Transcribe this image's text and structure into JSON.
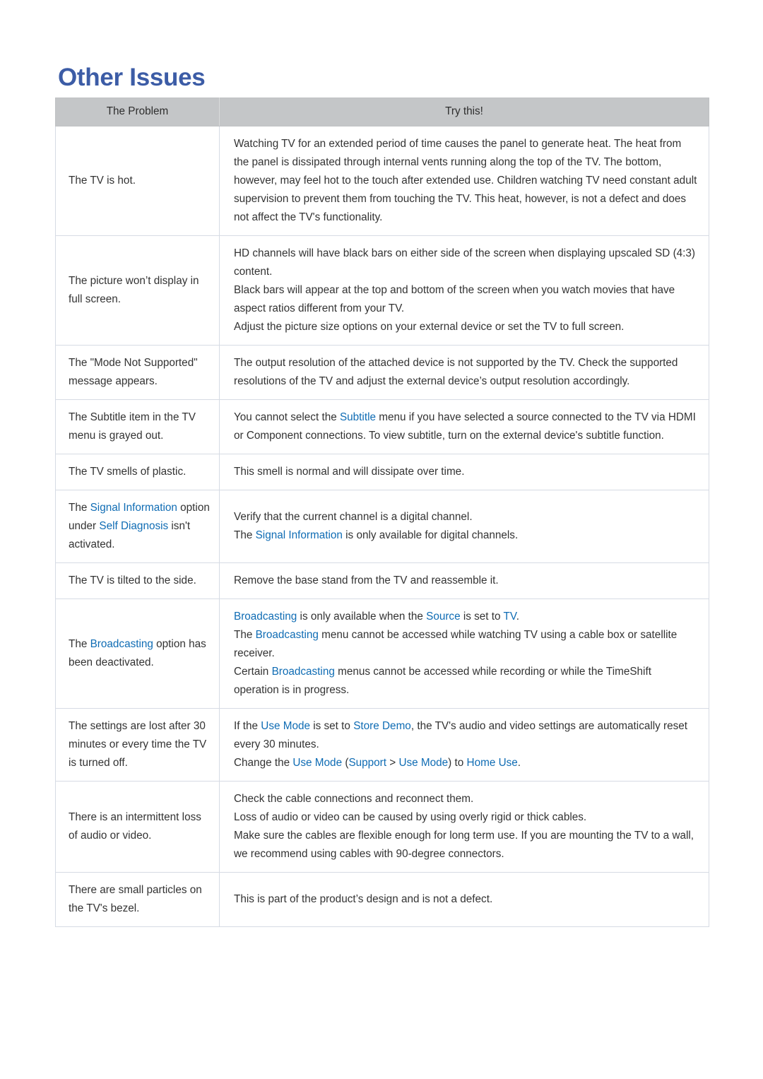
{
  "page": {
    "title": "Other Issues",
    "title_color": "#3c5ca6",
    "link_color": "#0f6cb4",
    "header_bg": "#c4c6c8"
  },
  "table": {
    "headers": {
      "problem": "The Problem",
      "try_this": "Try this!"
    },
    "rows": [
      {
        "problem_plain": "The TV is hot.",
        "problem_html": "The TV is hot.",
        "solution_lines_plain": [
          "Watching TV for an extended period of time causes the panel to generate heat. The heat from the panel is dissipated through internal vents running along the top of the TV. The bottom, however, may feel hot to the touch after extended use. Children watching TV need constant adult supervision to prevent them from touching the TV. This heat, however, is not a defect and does not affect the TV's functionality."
        ],
        "solution_html": "<span class=\"line\">Watching TV for an extended period of time causes the panel to generate heat. The heat from the panel is dissipated through internal vents running along the top of the TV. The bottom, however, may feel hot to the touch after extended use. Children watching TV need constant adult supervision to prevent them from touching the TV. This heat, however, is not a defect and does not affect the TV's functionality.</span>"
      },
      {
        "problem_plain": "The picture won’t display in full screen.",
        "problem_html": "The picture won’t display in full screen.",
        "solution_lines_plain": [
          "HD channels will have black bars on either side of the screen when displaying upscaled SD (4:3) content.",
          "Black bars will appear at the top and bottom of the screen when you watch movies that have aspect ratios different from your TV.",
          "Adjust the picture size options on your external device or set the TV to full screen."
        ],
        "solution_html": "<span class=\"line\">HD channels will have black bars on either side of the screen when displaying upscaled SD (4:3) content.</span><span class=\"line\">Black bars will appear at the top and bottom of the screen when you watch movies that have aspect ratios different from your TV.</span><span class=\"line\">Adjust the picture size options on your external device or set the TV to full screen.</span>"
      },
      {
        "problem_plain": "The \"Mode Not Supported\" message appears.",
        "problem_html": "The \"Mode Not Supported\" message appears.",
        "solution_lines_plain": [
          "The output resolution of the attached device is not supported by the TV. Check the supported resolutions of the TV and adjust the external device’s output resolution accordingly."
        ],
        "solution_html": "<span class=\"line\">The output resolution of the attached device is not supported by the TV. Check the supported resolutions of the TV and adjust the external device’s output resolution accordingly.</span>"
      },
      {
        "problem_plain": "The Subtitle item in the TV menu is grayed out.",
        "problem_html": "The Subtitle item in the TV menu is grayed out.",
        "solution_lines_plain": [
          "You cannot select the Subtitle menu if you have selected a source connected to the TV via HDMI or Component connections. To view subtitle, turn on the external device's subtitle function."
        ],
        "solution_html": "<span class=\"line\">You cannot select the <span class=\"hl\">Subtitle</span> menu if you have selected a source connected to the TV via HDMI or Component connections. To view subtitle, turn on the external device's subtitle function.</span>"
      },
      {
        "problem_plain": "The TV smells of plastic.",
        "problem_html": "The TV smells of plastic.",
        "solution_lines_plain": [
          "This smell is normal and will dissipate over time."
        ],
        "solution_html": "<span class=\"line\">This smell is normal and will dissipate over time.</span>"
      },
      {
        "problem_plain": "The Signal Information option under Self Diagnosis isn't activated.",
        "problem_html": "The <span class=\"hl\">Signal Information</span> option under <span class=\"hl\">Self Diagnosis</span> isn't activated.",
        "solution_lines_plain": [
          "Verify that the current channel is a digital channel.",
          "The Signal Information is only available for digital channels."
        ],
        "solution_html": "<span class=\"line\">Verify that the current channel is a digital channel.</span><span class=\"line\">The <span class=\"hl\">Signal Information</span> is only available for digital channels.</span>"
      },
      {
        "problem_plain": "The TV is tilted to the side.",
        "problem_html": "The TV is tilted to the side.",
        "solution_lines_plain": [
          "Remove the base stand from the TV and reassemble it."
        ],
        "solution_html": "<span class=\"line\">Remove the base stand from the TV and reassemble it.</span>"
      },
      {
        "problem_plain": "The Broadcasting option has been deactivated.",
        "problem_html": "The <span class=\"hl\">Broadcasting</span> option has been deactivated.",
        "solution_lines_plain": [
          "Broadcasting is only available when the Source is set to TV.",
          "The Broadcasting menu cannot be accessed while watching TV using a cable box or satellite receiver.",
          "Certain Broadcasting menus cannot be accessed while recording or while the TimeShift operation is in progress."
        ],
        "solution_html": "<span class=\"line\"><span class=\"hl\">Broadcasting</span> is only available when the <span class=\"hl\">Source</span> is set to <span class=\"hl\">TV</span>.</span><span class=\"line\">The <span class=\"hl\">Broadcasting</span> menu cannot be accessed while watching TV using a cable box or satellite receiver.</span><span class=\"line\">Certain <span class=\"hl\">Broadcasting</span> menus cannot be accessed while recording or while the TimeShift operation is in progress.</span>"
      },
      {
        "problem_plain": "The settings are lost after 30 minutes or every time the TV is turned off.",
        "problem_html": "The settings are lost after 30 minutes or every time the TV is turned off.",
        "solution_lines_plain": [
          "If the Use Mode is set to Store Demo, the TV's audio and video settings are automatically reset every 30 minutes.",
          "Change the Use Mode (Support > Use Mode) to Home Use."
        ],
        "solution_html": "<span class=\"line\">If the <span class=\"hl\">Use Mode</span> is set to <span class=\"hl\">Store Demo</span>, the TV's audio and video settings are automatically reset every 30 minutes.</span><span class=\"line\">Change the <span class=\"hl\">Use Mode</span> (<span class=\"hl\">Support</span> &gt; <span class=\"hl\">Use Mode</span>) to <span class=\"hl\">Home Use</span>.</span>"
      },
      {
        "problem_plain": "There is an intermittent loss of audio or video.",
        "problem_html": "There is an intermittent loss of audio or video.",
        "solution_lines_plain": [
          "Check the cable connections and reconnect them.",
          "Loss of audio or video can be caused by using overly rigid or thick cables.",
          "Make sure the cables are flexible enough for long term use. If you are mounting the TV to a wall, we recommend using cables with 90-degree connectors."
        ],
        "solution_html": "<span class=\"line\">Check the cable connections and reconnect them.</span><span class=\"line\">Loss of audio or video can be caused by using overly rigid or thick cables.</span><span class=\"line\">Make sure the cables are flexible enough for long term use. If you are mounting the TV to a wall, we recommend using cables with 90-degree connectors.</span>"
      },
      {
        "problem_plain": "There are small particles on the TV's bezel.",
        "problem_html": "There are small particles on the TV's bezel.",
        "solution_lines_plain": [
          "This is part of the product’s design and is not a defect."
        ],
        "solution_html": "<span class=\"line\">This is part of the product’s design and is not a defect.</span>"
      }
    ]
  }
}
